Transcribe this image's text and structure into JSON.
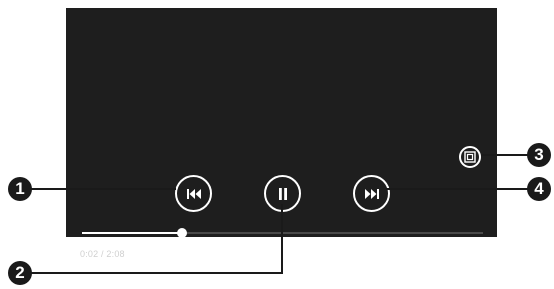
{
  "player": {
    "buttons": {
      "previous": "previous-track-icon",
      "pause": "pause-icon",
      "next": "next-track-icon",
      "fit_to_screen": "screen-fit-icon"
    },
    "progress_fraction": 0.25,
    "time_label": "0:02 / 2:08"
  },
  "callouts": {
    "c1": "1",
    "c2": "2",
    "c3": "3",
    "c4": "4"
  },
  "colors": {
    "player_bg": "#1e1e1e",
    "callout": "#1a1a1a",
    "controls": "#ffffff"
  }
}
